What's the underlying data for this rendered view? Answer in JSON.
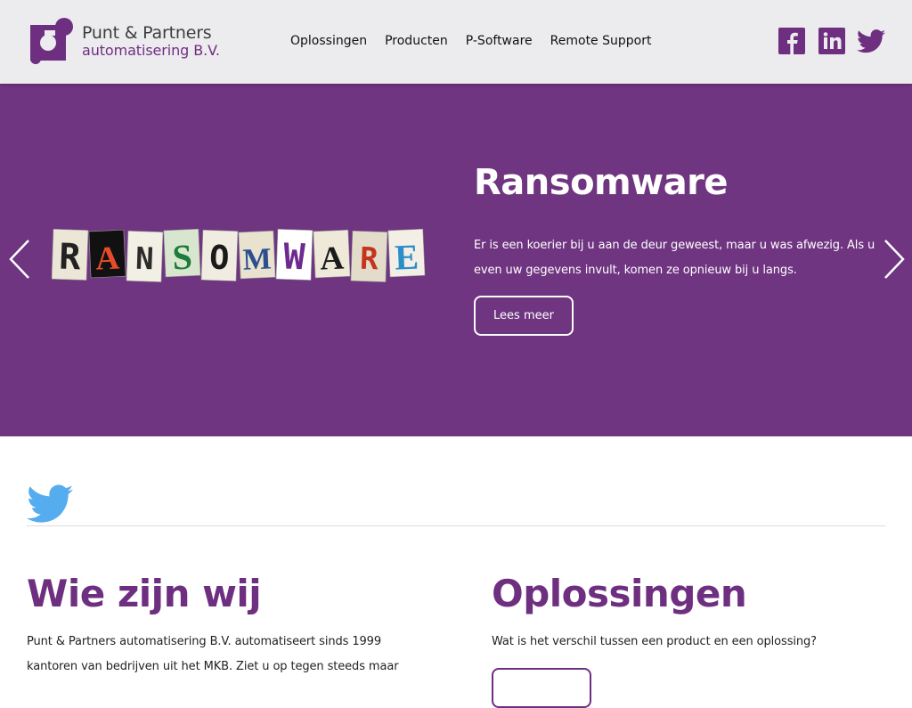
{
  "brand": {
    "name_line1": "Punt & Partners",
    "name_line2": "automatisering B.V.",
    "accent_color": "#6f2f80"
  },
  "nav": {
    "items": [
      {
        "label": "Oplossingen"
      },
      {
        "label": "Producten"
      },
      {
        "label": "P-Software"
      },
      {
        "label": "Remote Support"
      }
    ]
  },
  "social": {
    "icons": [
      "facebook-icon",
      "linkedin-icon",
      "twitter-icon"
    ]
  },
  "hero": {
    "background_color": "#6f3580",
    "image_text": "RANSOMWARE",
    "title": "Ransomware",
    "text": "Er is een koerier bij u aan de deur geweest, maar u was afwezig. Als u even uw gegevens invult, komen ze opnieuw bij u langs.",
    "button_label": "Lees meer",
    "prev_icon": "chevron-left-icon",
    "next_icon": "chevron-right-icon"
  },
  "twitter_feed": {
    "icon": "twitter-icon",
    "icon_color": "#55acee"
  },
  "sections": {
    "left": {
      "title": "Wie zijn wij",
      "text": "Punt & Partners automatisering B.V. automatiseert sinds 1999 kantoren van bedrijven uit het MKB. Ziet u op tegen steeds maar"
    },
    "right": {
      "title": "Oplossingen",
      "text": "Wat is het verschil tussen een product en een oplossing?"
    }
  }
}
